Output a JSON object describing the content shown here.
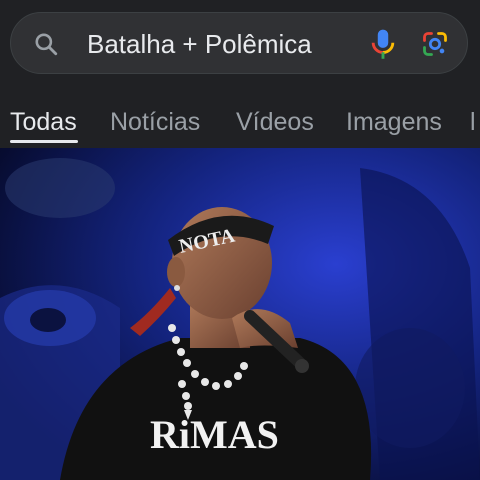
{
  "search": {
    "query": "Batalha + Polêmica"
  },
  "tabs": [
    {
      "label": "Todas",
      "active": true
    },
    {
      "label": "Notícias",
      "active": false
    },
    {
      "label": "Vídeos",
      "active": false
    },
    {
      "label": "Imagens",
      "active": false
    },
    {
      "label": "l",
      "active": false
    }
  ],
  "image": {
    "headband_text": "NOTA",
    "shirt_text": "RiMAS"
  },
  "colors": {
    "background": "#202124",
    "search_box": "#303134",
    "text_primary": "#e8eaed",
    "text_secondary": "#9aa0a6",
    "mic_blue": "#4285f4",
    "mic_red": "#ea4335",
    "mic_yellow": "#fbbc04",
    "mic_green": "#34a853"
  },
  "icons": [
    "search-icon",
    "microphone-icon",
    "google-lens-icon"
  ]
}
